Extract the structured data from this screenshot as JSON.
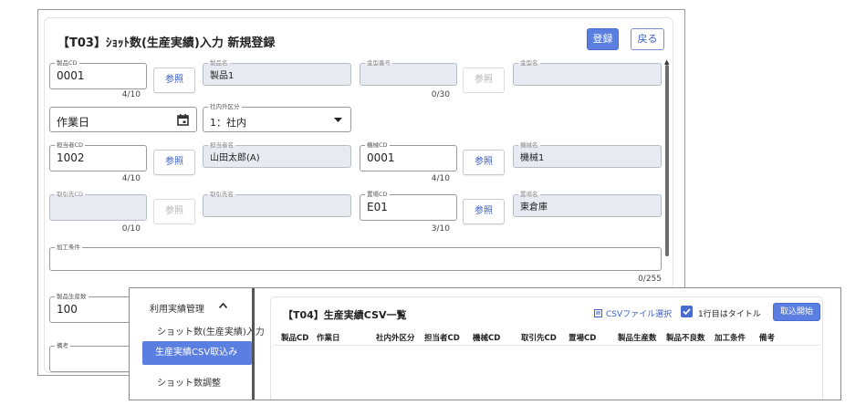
{
  "form": {
    "title": "【T03】ｼｮｯﾄ数(生産実績)入力 新規登録",
    "register_label": "登録",
    "back_label": "戻る",
    "ref_label": "参照",
    "product_cd": {
      "label": "製品CD",
      "value": "0001",
      "count": "4/10"
    },
    "product_name": {
      "label": "製品名",
      "value": "製品1"
    },
    "mold_no": {
      "label": "金型番号",
      "value": "",
      "count": "0/30"
    },
    "mold_name": {
      "label": "金型名",
      "value": ""
    },
    "work_date": {
      "placeholder": "作業日"
    },
    "inhouse_type": {
      "label": "社内外区分",
      "value": "1：社内"
    },
    "staff_cd": {
      "label": "担当者CD",
      "value": "1002",
      "count": "4/10"
    },
    "staff_name": {
      "label": "担当者名",
      "value": "山田太郎(A)"
    },
    "machine_cd": {
      "label": "機械CD",
      "value": "0001",
      "count": "4/10"
    },
    "machine_name": {
      "label": "機械名",
      "value": "機械1"
    },
    "customer_cd": {
      "label": "取引先CD",
      "value": "",
      "count": "0/10"
    },
    "customer_name": {
      "label": "取引先名",
      "value": ""
    },
    "warehouse_cd": {
      "label": "置場CD",
      "value": "E01",
      "count": "3/10"
    },
    "warehouse_name": {
      "label": "置場名",
      "value": "東倉庫"
    },
    "process_conditions": {
      "label": "加工条件",
      "value": "",
      "count": "0/255"
    },
    "production_qty": {
      "label": "製品生産数",
      "value": "100"
    },
    "remarks": {
      "label": "備考",
      "value": ""
    }
  },
  "sidebar": {
    "group_label": "利用実績管理",
    "items": [
      {
        "label": "ショット数(生産実績)入力"
      },
      {
        "label": "生産実績CSV取込み"
      },
      {
        "label": "ショット数調整"
      }
    ]
  },
  "csv": {
    "title": "【T04】生産実績CSV一覧",
    "file_select_label": "CSVファイル選択",
    "first_row_title_label": "1行目はタイトル",
    "first_row_title_checked": true,
    "start_label": "取込開始",
    "columns": [
      "製品CD",
      "作業日",
      "社内外区分",
      "担当者CD",
      "機械CD",
      "取引先CD",
      "置場CD",
      "製品生産数",
      "製品不良数",
      "加工条件",
      "備考"
    ]
  },
  "colors": {
    "accent": "#5b7fe0",
    "readonly_bg": "#e7ebf1"
  }
}
